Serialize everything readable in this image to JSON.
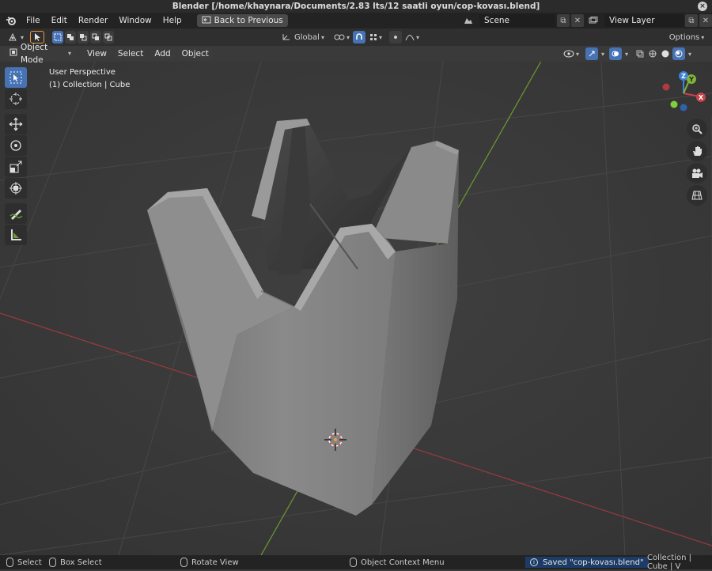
{
  "window": {
    "title": "Blender [/home/khaynara/Documents/2.83 lts/12 saatli oyun/cop-kovası.blend]"
  },
  "menubar": {
    "items": [
      "File",
      "Edit",
      "Render",
      "Window",
      "Help"
    ],
    "back_button": "Back to Previous",
    "scene_value": "Scene",
    "view_layer_value": "View Layer"
  },
  "toolheader": {
    "orientation": "Global",
    "options_label": "Options"
  },
  "viewport_header": {
    "mode": "Object Mode",
    "menus": [
      "View",
      "Select",
      "Add",
      "Object"
    ]
  },
  "viewport": {
    "perspective_label": "User Perspective",
    "collection_label": "(1) Collection | Cube",
    "gizmo_axes": {
      "x": "X",
      "y": "Y",
      "z": "Z"
    }
  },
  "toolbar_tools": [
    "select-box-icon",
    "cursor-icon",
    "move-icon",
    "rotate-icon",
    "scale-icon",
    "transform-icon",
    "annotate-icon",
    "measure-icon"
  ],
  "nav_buttons": [
    "zoom-icon",
    "hand-pan-icon",
    "camera-icon",
    "grid-icon"
  ],
  "statusbar": {
    "select": "Select",
    "box_select": "Box Select",
    "rotate_view": "Rotate View",
    "context_menu": "Object Context Menu",
    "saved_message": "Saved \"cop-kovası.blend\"",
    "stats": "Collection | Cube | V"
  },
  "colors": {
    "accent": "#4772b3",
    "x_axis": "#c8434b",
    "y_axis": "#7fb43a",
    "z_axis": "#3f7fd6",
    "grid_red": "#9a3a3e",
    "grid_green": "#6c9a2e"
  }
}
